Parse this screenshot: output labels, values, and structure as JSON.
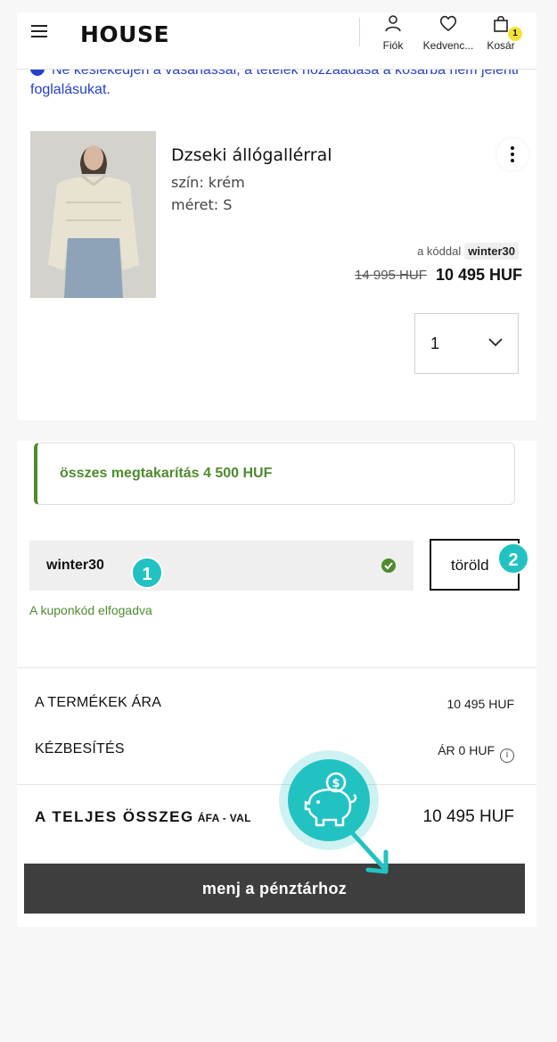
{
  "header": {
    "logo": "HOUSE",
    "account_label": "Fiók",
    "favorites_label": "Kedvenc...",
    "cart_label": "Kosár",
    "cart_count": "1"
  },
  "notice": {
    "text": "Ne késlekedjen a vásárlással, a tételek hozzáadása a kosárba nem jelenti foglalásukat."
  },
  "product": {
    "name": "Dzseki állógallérral",
    "color": "szín: krém",
    "size": "méret: S",
    "code_prefix": "a kóddal",
    "code": "winter30",
    "old_price": "14 995 HUF",
    "new_price": "10 495 HUF",
    "quantity": "1"
  },
  "savings": {
    "text": "összes megtakarítás 4 500 HUF"
  },
  "coupon": {
    "value": "winter30",
    "delete_label": "töröld",
    "accepted_text": "A  kuponkód elfogadva"
  },
  "summary": {
    "products_label": "A TERMÉKEK ÁRA",
    "products_value": "10 495 HUF",
    "delivery_label": "KÉZBESÍTÉS",
    "delivery_value": "ÁR 0 HUF",
    "total_label": "A TELJES ÖSSZEG",
    "total_suffix": "ÁFA - VAL",
    "total_value": "10 495 HUF"
  },
  "checkout_label": "menj a pénztárhoz",
  "steps": [
    "1",
    "2"
  ],
  "colors": {
    "accent_green": "#4f8b2e",
    "step_teal": "#22c2c2",
    "notice_blue": "#2740c9",
    "checkout_bg": "#3e3e3e"
  }
}
